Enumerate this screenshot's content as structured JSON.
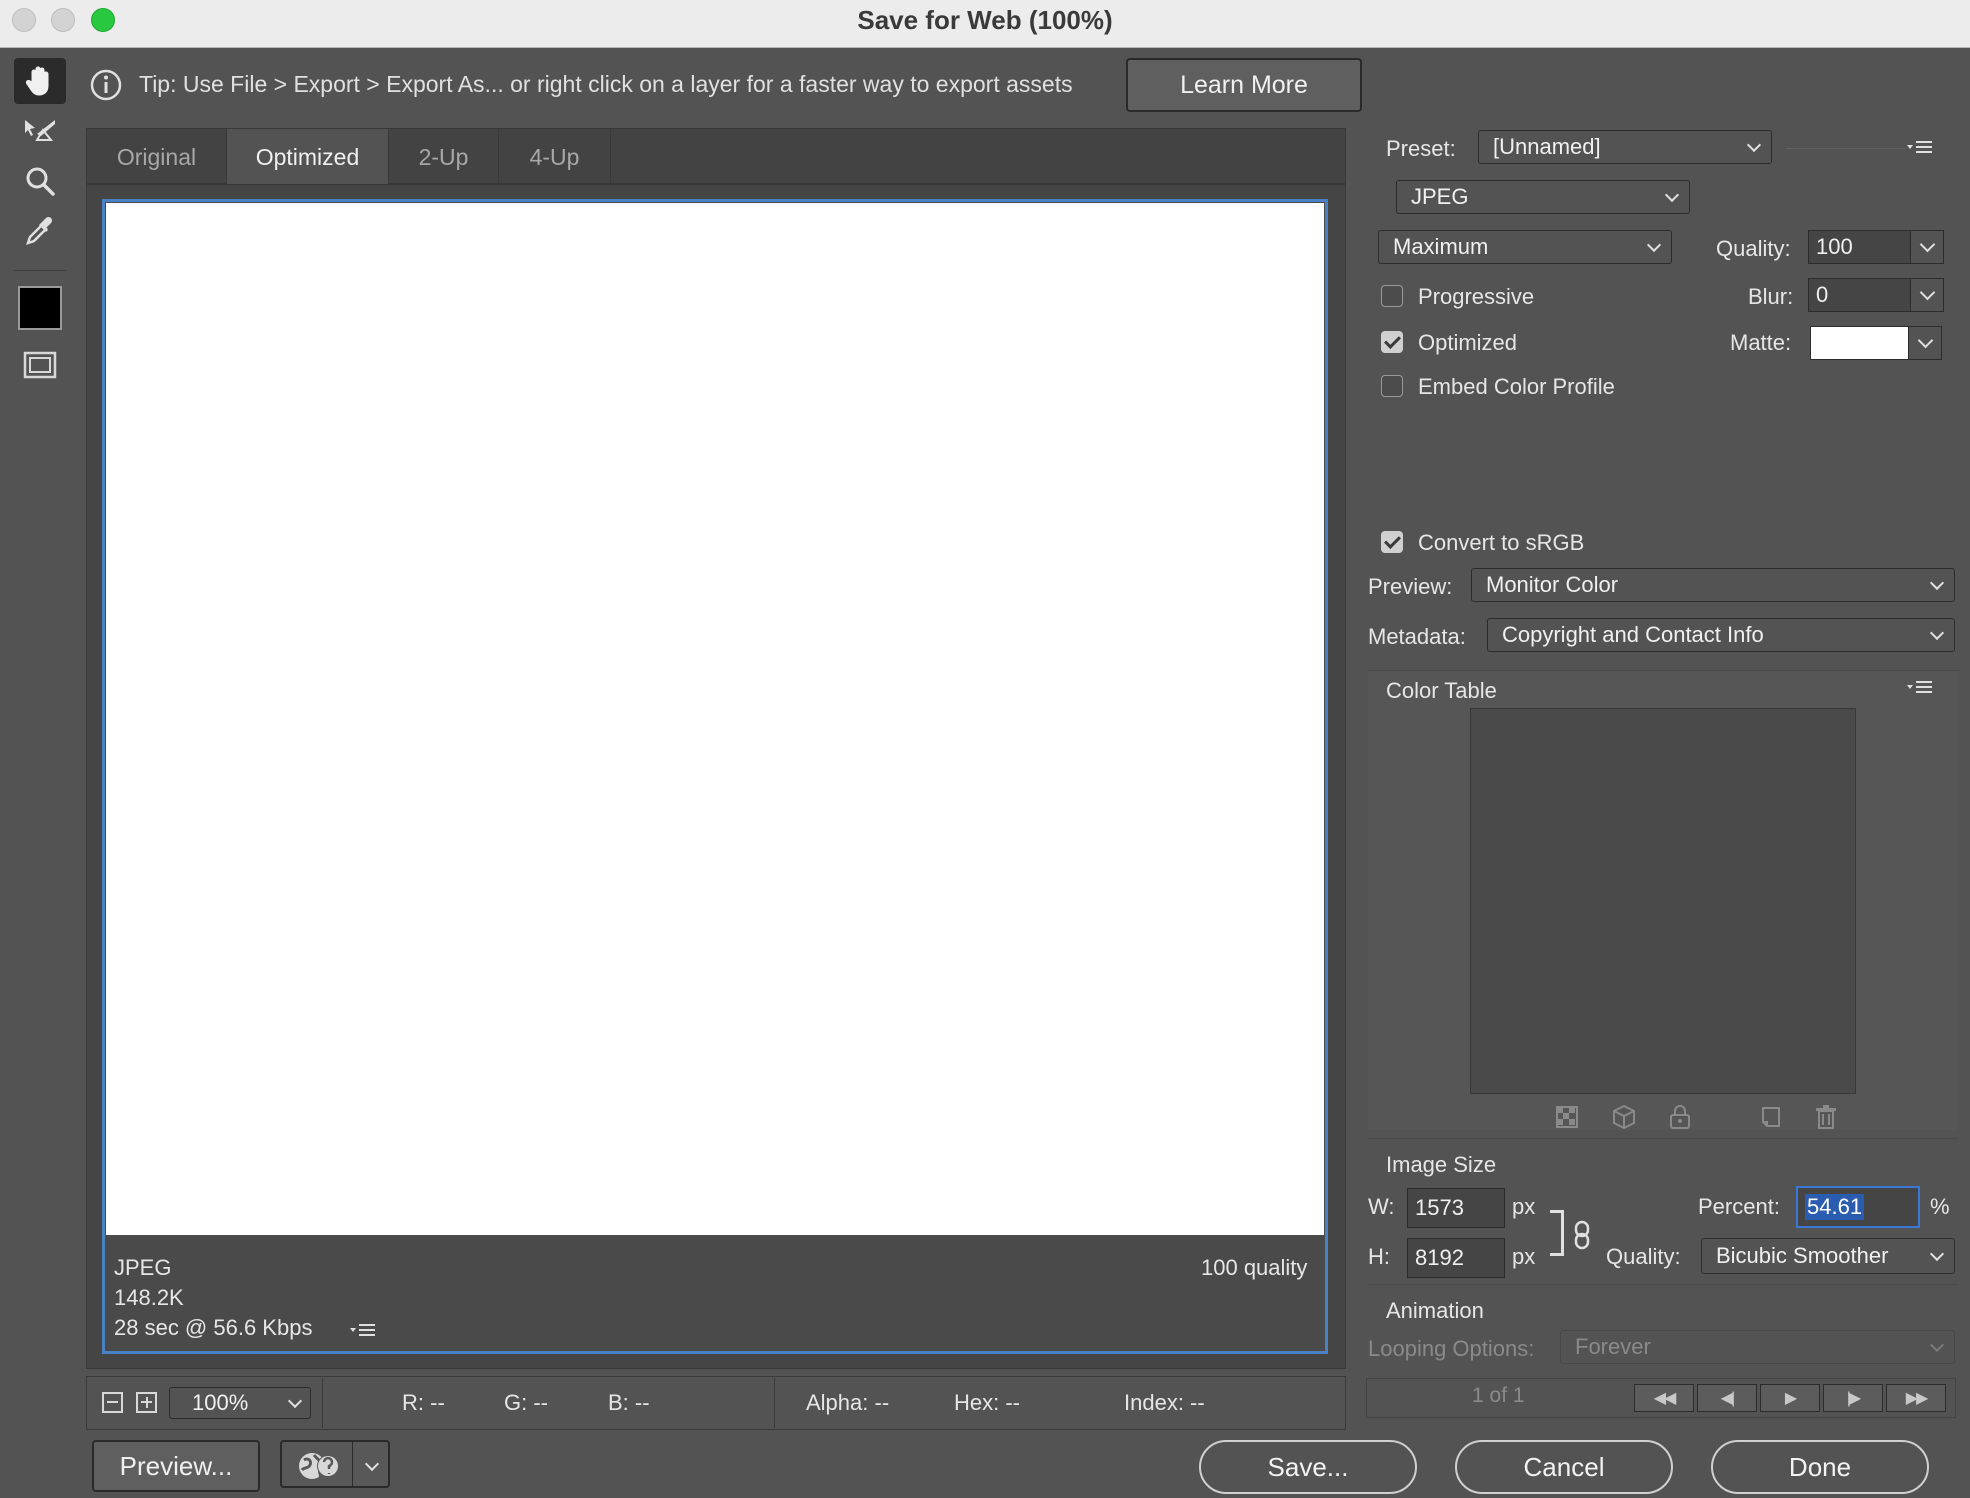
{
  "window": {
    "title": "Save for Web (100%)"
  },
  "tip": {
    "text": "Tip: Use File > Export > Export As...  or right click on a layer for a faster way to export assets",
    "learn_more": "Learn More"
  },
  "tabs": [
    {
      "label": "Original"
    },
    {
      "label": "Optimized",
      "active": true
    },
    {
      "label": "2-Up"
    },
    {
      "label": "4-Up"
    }
  ],
  "image_info": {
    "format": "JPEG",
    "size": "148.2K",
    "download_time": "28 sec @ 56.6 Kbps",
    "quality_note": "100 quality"
  },
  "settings": {
    "preset_label": "Preset:",
    "preset_value": "[Unnamed]",
    "format_value": "JPEG",
    "compression_value": "Maximum",
    "quality_label": "Quality:",
    "quality_value": "100",
    "blur_label": "Blur:",
    "blur_value": "0",
    "matte_label": "Matte:",
    "matte_color": "#ffffff",
    "progressive_label": "Progressive",
    "progressive_checked": false,
    "optimized_label": "Optimized",
    "optimized_checked": true,
    "embed_label": "Embed Color Profile",
    "embed_checked": false,
    "convert_label": "Convert to sRGB",
    "convert_checked": true,
    "preview_label": "Preview:",
    "preview_value": "Monitor Color",
    "metadata_label": "Metadata:",
    "metadata_value": "Copyright and Contact Info"
  },
  "color_table": {
    "title": "Color Table"
  },
  "image_size": {
    "title": "Image Size",
    "w_label": "W:",
    "w_value": "1573",
    "h_label": "H:",
    "h_value": "8192",
    "unit": "px",
    "percent_label": "Percent:",
    "percent_value": "54.61",
    "percent_sign": "%",
    "quality_label": "Quality:",
    "quality_value": "Bicubic Smoother"
  },
  "animation": {
    "title": "Animation",
    "looping_label": "Looping Options:",
    "looping_value": "Forever",
    "frame_counter": "1 of 1"
  },
  "status": {
    "zoom": "100%",
    "r": "R: --",
    "g": "G: --",
    "b": "B: --",
    "alpha": "Alpha: --",
    "hex": "Hex: --",
    "index": "Index: --"
  },
  "buttons": {
    "preview": "Preview...",
    "save": "Save...",
    "cancel": "Cancel",
    "done": "Done"
  },
  "colors": {
    "accent": "#4a80c4",
    "panel": "#535353",
    "selection": "#2a5db0"
  }
}
